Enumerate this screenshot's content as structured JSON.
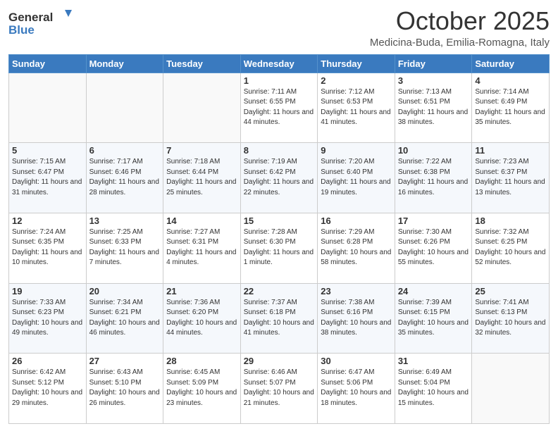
{
  "header": {
    "logo_general": "General",
    "logo_blue": "Blue",
    "month_title": "October 2025",
    "location": "Medicina-Buda, Emilia-Romagna, Italy"
  },
  "weekdays": [
    "Sunday",
    "Monday",
    "Tuesday",
    "Wednesday",
    "Thursday",
    "Friday",
    "Saturday"
  ],
  "weeks": [
    [
      {
        "day": "",
        "sunrise": "",
        "sunset": "",
        "daylight": ""
      },
      {
        "day": "",
        "sunrise": "",
        "sunset": "",
        "daylight": ""
      },
      {
        "day": "",
        "sunrise": "",
        "sunset": "",
        "daylight": ""
      },
      {
        "day": "1",
        "sunrise": "Sunrise: 7:11 AM",
        "sunset": "Sunset: 6:55 PM",
        "daylight": "Daylight: 11 hours and 44 minutes."
      },
      {
        "day": "2",
        "sunrise": "Sunrise: 7:12 AM",
        "sunset": "Sunset: 6:53 PM",
        "daylight": "Daylight: 11 hours and 41 minutes."
      },
      {
        "day": "3",
        "sunrise": "Sunrise: 7:13 AM",
        "sunset": "Sunset: 6:51 PM",
        "daylight": "Daylight: 11 hours and 38 minutes."
      },
      {
        "day": "4",
        "sunrise": "Sunrise: 7:14 AM",
        "sunset": "Sunset: 6:49 PM",
        "daylight": "Daylight: 11 hours and 35 minutes."
      }
    ],
    [
      {
        "day": "5",
        "sunrise": "Sunrise: 7:15 AM",
        "sunset": "Sunset: 6:47 PM",
        "daylight": "Daylight: 11 hours and 31 minutes."
      },
      {
        "day": "6",
        "sunrise": "Sunrise: 7:17 AM",
        "sunset": "Sunset: 6:46 PM",
        "daylight": "Daylight: 11 hours and 28 minutes."
      },
      {
        "day": "7",
        "sunrise": "Sunrise: 7:18 AM",
        "sunset": "Sunset: 6:44 PM",
        "daylight": "Daylight: 11 hours and 25 minutes."
      },
      {
        "day": "8",
        "sunrise": "Sunrise: 7:19 AM",
        "sunset": "Sunset: 6:42 PM",
        "daylight": "Daylight: 11 hours and 22 minutes."
      },
      {
        "day": "9",
        "sunrise": "Sunrise: 7:20 AM",
        "sunset": "Sunset: 6:40 PM",
        "daylight": "Daylight: 11 hours and 19 minutes."
      },
      {
        "day": "10",
        "sunrise": "Sunrise: 7:22 AM",
        "sunset": "Sunset: 6:38 PM",
        "daylight": "Daylight: 11 hours and 16 minutes."
      },
      {
        "day": "11",
        "sunrise": "Sunrise: 7:23 AM",
        "sunset": "Sunset: 6:37 PM",
        "daylight": "Daylight: 11 hours and 13 minutes."
      }
    ],
    [
      {
        "day": "12",
        "sunrise": "Sunrise: 7:24 AM",
        "sunset": "Sunset: 6:35 PM",
        "daylight": "Daylight: 11 hours and 10 minutes."
      },
      {
        "day": "13",
        "sunrise": "Sunrise: 7:25 AM",
        "sunset": "Sunset: 6:33 PM",
        "daylight": "Daylight: 11 hours and 7 minutes."
      },
      {
        "day": "14",
        "sunrise": "Sunrise: 7:27 AM",
        "sunset": "Sunset: 6:31 PM",
        "daylight": "Daylight: 11 hours and 4 minutes."
      },
      {
        "day": "15",
        "sunrise": "Sunrise: 7:28 AM",
        "sunset": "Sunset: 6:30 PM",
        "daylight": "Daylight: 11 hours and 1 minute."
      },
      {
        "day": "16",
        "sunrise": "Sunrise: 7:29 AM",
        "sunset": "Sunset: 6:28 PM",
        "daylight": "Daylight: 10 hours and 58 minutes."
      },
      {
        "day": "17",
        "sunrise": "Sunrise: 7:30 AM",
        "sunset": "Sunset: 6:26 PM",
        "daylight": "Daylight: 10 hours and 55 minutes."
      },
      {
        "day": "18",
        "sunrise": "Sunrise: 7:32 AM",
        "sunset": "Sunset: 6:25 PM",
        "daylight": "Daylight: 10 hours and 52 minutes."
      }
    ],
    [
      {
        "day": "19",
        "sunrise": "Sunrise: 7:33 AM",
        "sunset": "Sunset: 6:23 PM",
        "daylight": "Daylight: 10 hours and 49 minutes."
      },
      {
        "day": "20",
        "sunrise": "Sunrise: 7:34 AM",
        "sunset": "Sunset: 6:21 PM",
        "daylight": "Daylight: 10 hours and 46 minutes."
      },
      {
        "day": "21",
        "sunrise": "Sunrise: 7:36 AM",
        "sunset": "Sunset: 6:20 PM",
        "daylight": "Daylight: 10 hours and 44 minutes."
      },
      {
        "day": "22",
        "sunrise": "Sunrise: 7:37 AM",
        "sunset": "Sunset: 6:18 PM",
        "daylight": "Daylight: 10 hours and 41 minutes."
      },
      {
        "day": "23",
        "sunrise": "Sunrise: 7:38 AM",
        "sunset": "Sunset: 6:16 PM",
        "daylight": "Daylight: 10 hours and 38 minutes."
      },
      {
        "day": "24",
        "sunrise": "Sunrise: 7:39 AM",
        "sunset": "Sunset: 6:15 PM",
        "daylight": "Daylight: 10 hours and 35 minutes."
      },
      {
        "day": "25",
        "sunrise": "Sunrise: 7:41 AM",
        "sunset": "Sunset: 6:13 PM",
        "daylight": "Daylight: 10 hours and 32 minutes."
      }
    ],
    [
      {
        "day": "26",
        "sunrise": "Sunrise: 6:42 AM",
        "sunset": "Sunset: 5:12 PM",
        "daylight": "Daylight: 10 hours and 29 minutes."
      },
      {
        "day": "27",
        "sunrise": "Sunrise: 6:43 AM",
        "sunset": "Sunset: 5:10 PM",
        "daylight": "Daylight: 10 hours and 26 minutes."
      },
      {
        "day": "28",
        "sunrise": "Sunrise: 6:45 AM",
        "sunset": "Sunset: 5:09 PM",
        "daylight": "Daylight: 10 hours and 23 minutes."
      },
      {
        "day": "29",
        "sunrise": "Sunrise: 6:46 AM",
        "sunset": "Sunset: 5:07 PM",
        "daylight": "Daylight: 10 hours and 21 minutes."
      },
      {
        "day": "30",
        "sunrise": "Sunrise: 6:47 AM",
        "sunset": "Sunset: 5:06 PM",
        "daylight": "Daylight: 10 hours and 18 minutes."
      },
      {
        "day": "31",
        "sunrise": "Sunrise: 6:49 AM",
        "sunset": "Sunset: 5:04 PM",
        "daylight": "Daylight: 10 hours and 15 minutes."
      },
      {
        "day": "",
        "sunrise": "",
        "sunset": "",
        "daylight": ""
      }
    ]
  ]
}
